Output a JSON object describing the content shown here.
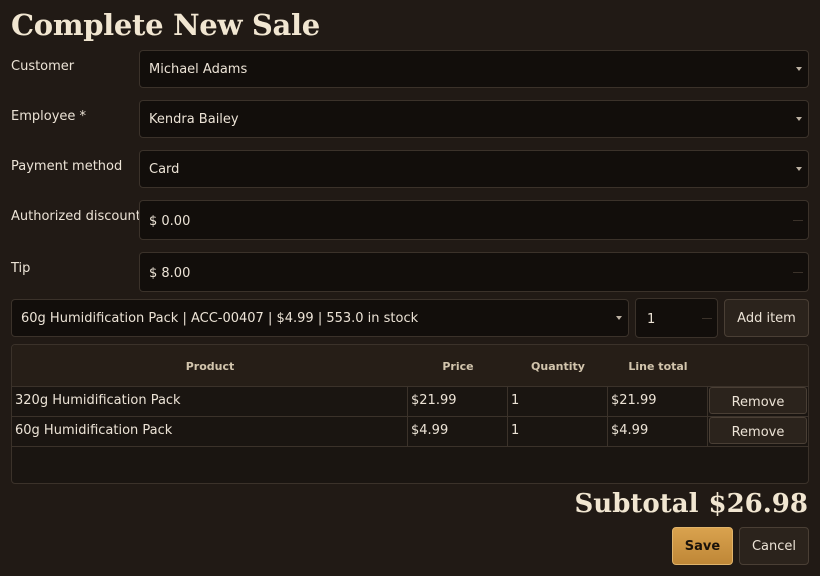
{
  "title": "Complete New Sale",
  "form": {
    "customer": {
      "label": "Customer",
      "value": "Michael Adams"
    },
    "employee": {
      "label": "Employee *",
      "value": "Kendra Bailey"
    },
    "payment_method": {
      "label": "Payment method",
      "value": "Card"
    },
    "authorized_discount": {
      "label": "Authorized discount",
      "value": "$ 0.00"
    },
    "tip": {
      "label": "Tip",
      "value": "$ 8.00"
    }
  },
  "item_picker": {
    "selected": "60g Humidification Pack  |  ACC-00407  |  $4.99  |  553.0 in stock",
    "quantity": "1",
    "add_label": "Add item"
  },
  "table": {
    "headers": [
      "Product",
      "Price",
      "Quantity",
      "Line total"
    ],
    "rows": [
      {
        "product": "320g Humidification Pack",
        "price": "$21.99",
        "quantity": "1",
        "line_total": "$21.99",
        "action": "Remove"
      },
      {
        "product": "60g Humidification Pack",
        "price": "$4.99",
        "quantity": "1",
        "line_total": "$4.99",
        "action": "Remove"
      }
    ]
  },
  "summary": {
    "subtotal_label": "Subtotal",
    "subtotal_value": "$26.98"
  },
  "actions": {
    "save_label": "Save",
    "cancel_label": "Cancel"
  },
  "colors": {
    "background": "#211a15",
    "field_background": "#120e0b",
    "accent_gold": "#c9943f",
    "text": "#ece3d6"
  }
}
